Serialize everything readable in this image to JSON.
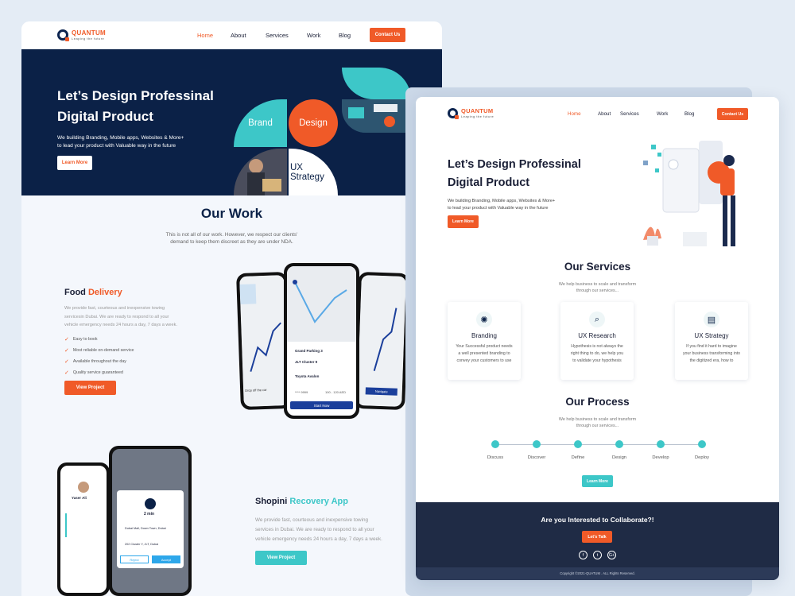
{
  "brand": {
    "name": "QUANTUM",
    "tagline": "Leaping the future"
  },
  "nav": {
    "items": [
      "Home",
      "About",
      "Services",
      "Work",
      "Blog"
    ],
    "cta": "Contact Us"
  },
  "hero": {
    "title_line1": "Let’s Design Professinal",
    "title_line2": "Digital Product",
    "desc_line1": "We building Branding, Mobile apps, Websites & More+",
    "desc_line2": "to lead your product with Valuable way in the future",
    "button": "Learn More",
    "tiles": [
      "Brand",
      "Design",
      "UX",
      "Strategy"
    ]
  },
  "work": {
    "title": "Our Work",
    "desc_line1": "This is not all of our work. However, we respect our clients'",
    "desc_line2": "demand to keep them discreet as they are under NDA.",
    "projects": [
      {
        "title_a": "Food ",
        "title_b": "Delivery",
        "desc_line1": "We provide fast, courteous and inexpensive towing",
        "desc_line2": "servicesin Dubai. We are ready to respond to all your",
        "desc_line3": "vehicle emergency needs 24 hours a day, 7 days a week.",
        "features": [
          "Easy to book",
          "Most reliable on-demand service",
          "Available throughout the day",
          "Quality service guaranteed"
        ],
        "button": "View Project"
      },
      {
        "title_a": "Shopini ",
        "title_b": "Recovery App",
        "desc_line1": "We provide fast, courteous and inexpensive towing",
        "desc_line2": "services in Dubai. We are ready to respond to all your",
        "desc_line3": "vehicle emergency needs 24 hours a day, 7 days a week.",
        "button": "View Project"
      }
    ]
  },
  "phones": {
    "food": {
      "start": "Start Now",
      "navigate": "Navigate",
      "dropoff": "Drop off the car",
      "place1": "Grand Parking 3",
      "place2": "JLT Cluster 9",
      "place3": "Toyota Avalon",
      "plate": "**** 9999",
      "time": "100 - 120 AED"
    },
    "recovery": {
      "mins": "2 min",
      "pickup": "Dubai Mall, Down Town, Dubai",
      "delivery": "202 Cluster Y, JLT, Dubai",
      "reject": "Reject",
      "accept": "Accept",
      "user": "Yaser Ali"
    }
  },
  "services": {
    "title": "Our Services",
    "desc_line1": "We help business to scale and transform",
    "desc_line2": "through our services...",
    "items": [
      {
        "title": "Branding",
        "d1": "Your Successful product needs",
        "d2": "a well presented branding to",
        "d3": "convey your customers to use",
        "icon": "bulb-icon"
      },
      {
        "title": "UX Research",
        "d1": "Hypothesis is not always the",
        "d2": "right thing to do, we help you",
        "d3": "to validate your hypothesis",
        "icon": "search-icon"
      },
      {
        "title": "UX Strategy",
        "d1": "If you find it hard to imagine",
        "d2": "your business transforming into",
        "d3": "the digitized era, how to",
        "icon": "clipboard-icon"
      }
    ]
  },
  "process": {
    "title": "Our Process",
    "desc_line1": "We help business to scale and transform",
    "desc_line2": "through our services...",
    "steps": [
      "Discuss",
      "Discover",
      "Define",
      "Design",
      "Develop",
      "Deploy"
    ],
    "button": "Learn More"
  },
  "footer": {
    "cta_title": "Are you Interested to Collaborate?!",
    "button": "Let’s  Talk",
    "social": [
      "f",
      "t",
      "G+"
    ],
    "copyright": "Copyright ©2021-QUATUM . ALL Rights Reserved."
  },
  "colors": {
    "accent": "#f05a28",
    "teal": "#3dc7c8",
    "navy": "#0b2147",
    "footer": "#1f2b45"
  }
}
